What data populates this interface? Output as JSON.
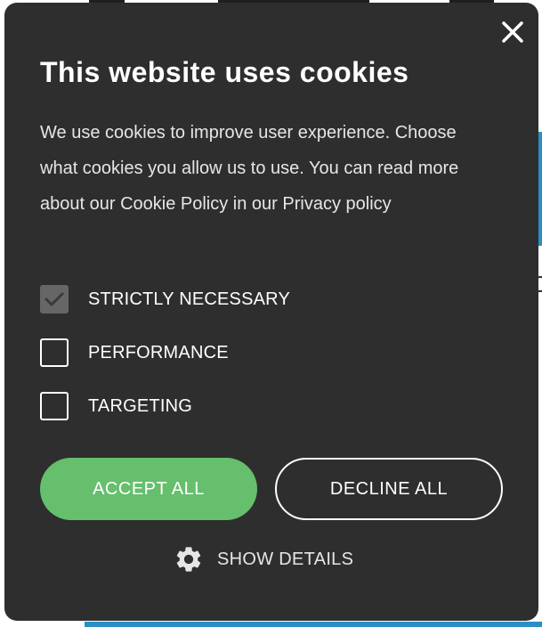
{
  "dialog": {
    "title": "This website uses cookies",
    "description_before_link": "We use cookies to improve user experience. Choose what cookies you allow us to use. You can read more about our Cookie Policy in our ",
    "privacy_link": "Privacy policy",
    "close_icon": "close-icon",
    "options": [
      {
        "label": "STRICTLY NECESSARY",
        "checked": true,
        "disabled": true
      },
      {
        "label": "PERFORMANCE",
        "checked": false,
        "disabled": false
      },
      {
        "label": "TARGETING",
        "checked": false,
        "disabled": false
      }
    ],
    "accept_label": "ACCEPT ALL",
    "decline_label": "DECLINE ALL",
    "details_label": "SHOW DETAILS",
    "details_icon": "gear-icon"
  },
  "colors": {
    "dialog_bg": "#2e2e2e",
    "accept_bg": "#65bf6c",
    "checked_disabled_bg": "#666666",
    "background_accent": "#2a8fc4"
  }
}
